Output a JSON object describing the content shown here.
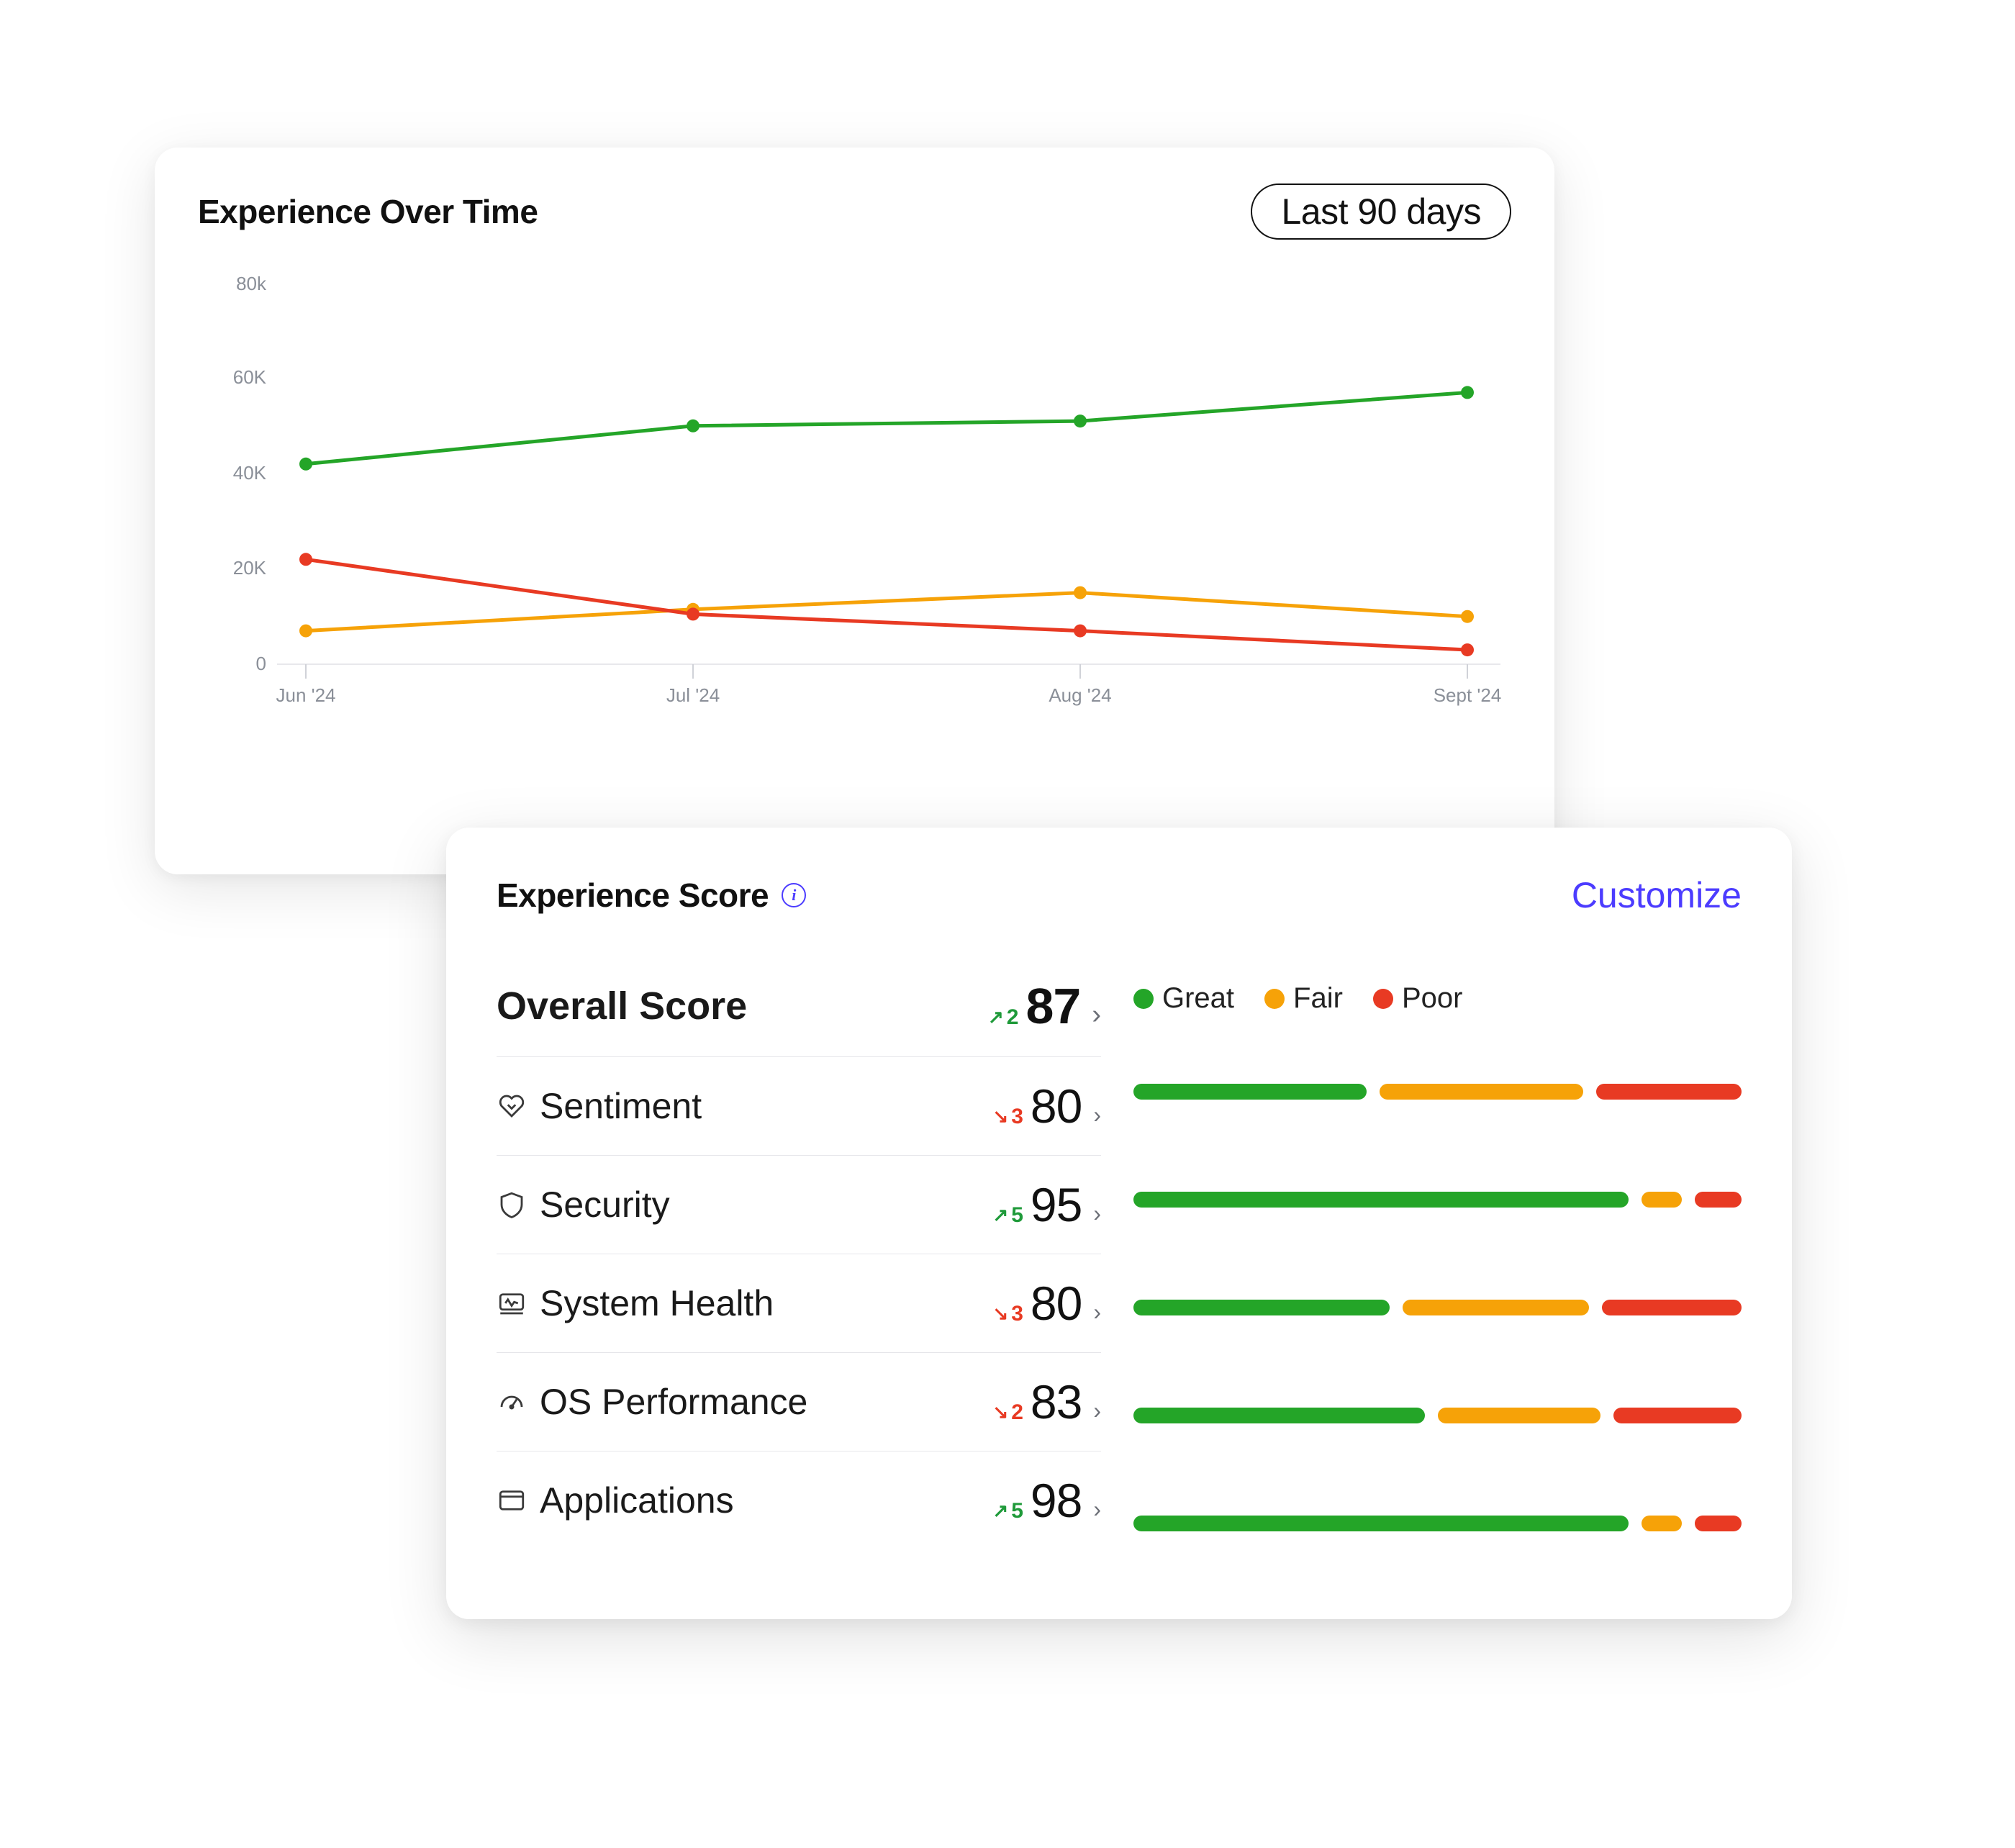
{
  "chart": {
    "title": "Experience Over Time",
    "range_label": "Last 90 days",
    "y_ticks": [
      "0",
      "20K",
      "40K",
      "60K",
      "80k"
    ],
    "x_ticks": [
      "Jun '24",
      "Jul '24",
      "Aug '24",
      "Sept '24"
    ]
  },
  "chart_data": {
    "type": "line",
    "title": "Experience Over Time",
    "xlabel": "",
    "ylabel": "",
    "ylim": [
      0,
      80000
    ],
    "categories": [
      "Jun '24",
      "Jul '24",
      "Aug '24",
      "Sept '24"
    ],
    "series": [
      {
        "name": "Great",
        "color": "#24a528",
        "values": [
          42000,
          50000,
          51000,
          57000
        ]
      },
      {
        "name": "Fair",
        "color": "#f6a208",
        "values": [
          7000,
          11500,
          15000,
          10000
        ]
      },
      {
        "name": "Poor",
        "color": "#e83a23",
        "values": [
          22000,
          10500,
          7000,
          3000
        ]
      }
    ]
  },
  "score": {
    "title": "Experience Score",
    "customize_label": "Customize",
    "legend": {
      "great": "Great",
      "fair": "Fair",
      "poor": "Poor"
    },
    "overall": {
      "label": "Overall Score",
      "delta_dir": "up",
      "delta": "2",
      "value": "87"
    },
    "metrics": [
      {
        "key": "sentiment",
        "label": "Sentiment",
        "delta_dir": "down",
        "delta": "3",
        "value": "80",
        "bars": {
          "great": 40,
          "fair": 35,
          "poor": 25
        }
      },
      {
        "key": "security",
        "label": "Security",
        "delta_dir": "up",
        "delta": "5",
        "value": "95",
        "bars": {
          "great": 85,
          "fair": 7,
          "poor": 8
        }
      },
      {
        "key": "system-health",
        "label": "System Health",
        "delta_dir": "down",
        "delta": "3",
        "value": "80",
        "bars": {
          "great": 44,
          "fair": 32,
          "poor": 24
        }
      },
      {
        "key": "os-perf",
        "label": "OS Performance",
        "delta_dir": "down",
        "delta": "2",
        "value": "83",
        "bars": {
          "great": 50,
          "fair": 28,
          "poor": 22
        }
      },
      {
        "key": "applications",
        "label": "Applications",
        "delta_dir": "up",
        "delta": "5",
        "value": "98",
        "bars": {
          "great": 85,
          "fair": 7,
          "poor": 8
        }
      }
    ]
  }
}
